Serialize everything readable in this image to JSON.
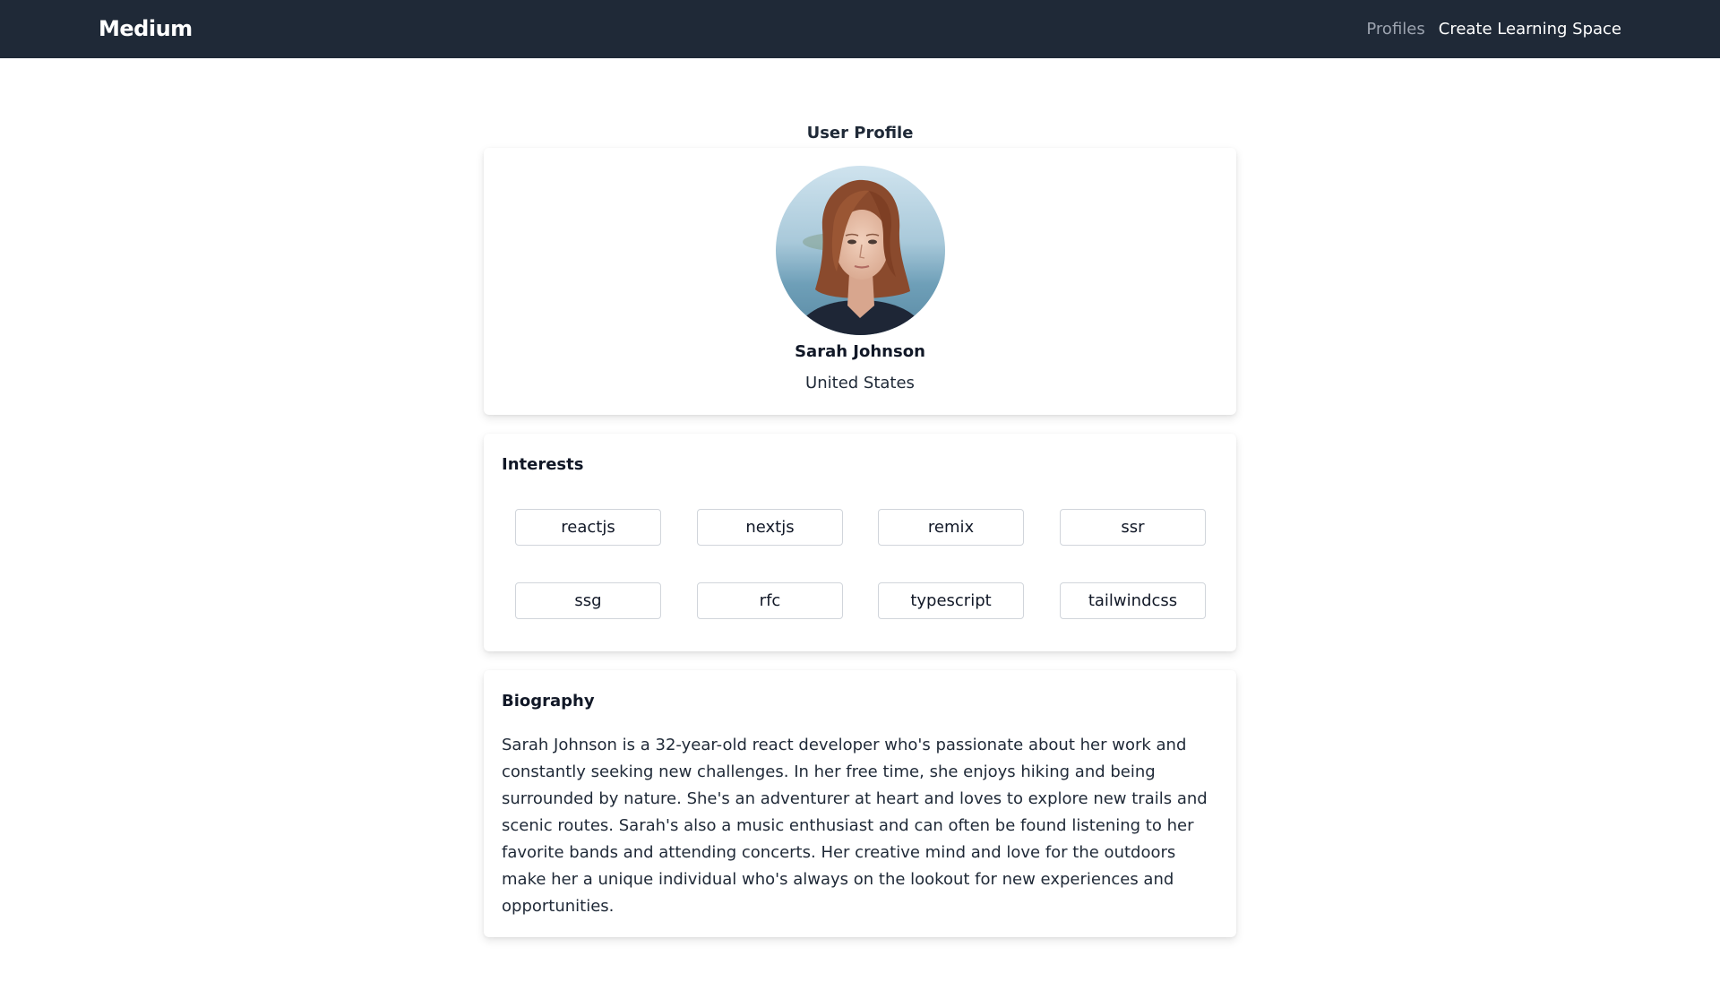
{
  "navbar": {
    "brand": "Medium",
    "links": [
      {
        "label": "Profiles"
      },
      {
        "label": "Create Learning Space"
      }
    ]
  },
  "page": {
    "heading": "User Profile"
  },
  "profile": {
    "name": "Sarah Johnson",
    "country": "United States",
    "avatar_icon": "user-avatar-photo"
  },
  "interests": {
    "title": "Interests",
    "tags": [
      "reactjs",
      "nextjs",
      "remix",
      "ssr",
      "ssg",
      "rfc",
      "typescript",
      "tailwindcss"
    ]
  },
  "biography": {
    "title": "Biography",
    "text": "Sarah Johnson is a 32-year-old react developer who's passionate about her work and constantly seeking new challenges. In her free time, she enjoys hiking and being surrounded by nature. She's an adventurer at heart and loves to explore new trails and scenic routes. Sarah's also a music enthusiast and can often be found listening to her favorite bands and attending concerts. Her creative mind and love for the outdoors make her a unique individual who's always on the lookout for new experiences and opportunities."
  },
  "colors": {
    "navbar_bg": "#1f2937",
    "nav_link_muted": "#9ca3af",
    "nav_link_active": "#ffffff",
    "tag_border": "#d1d5db"
  }
}
